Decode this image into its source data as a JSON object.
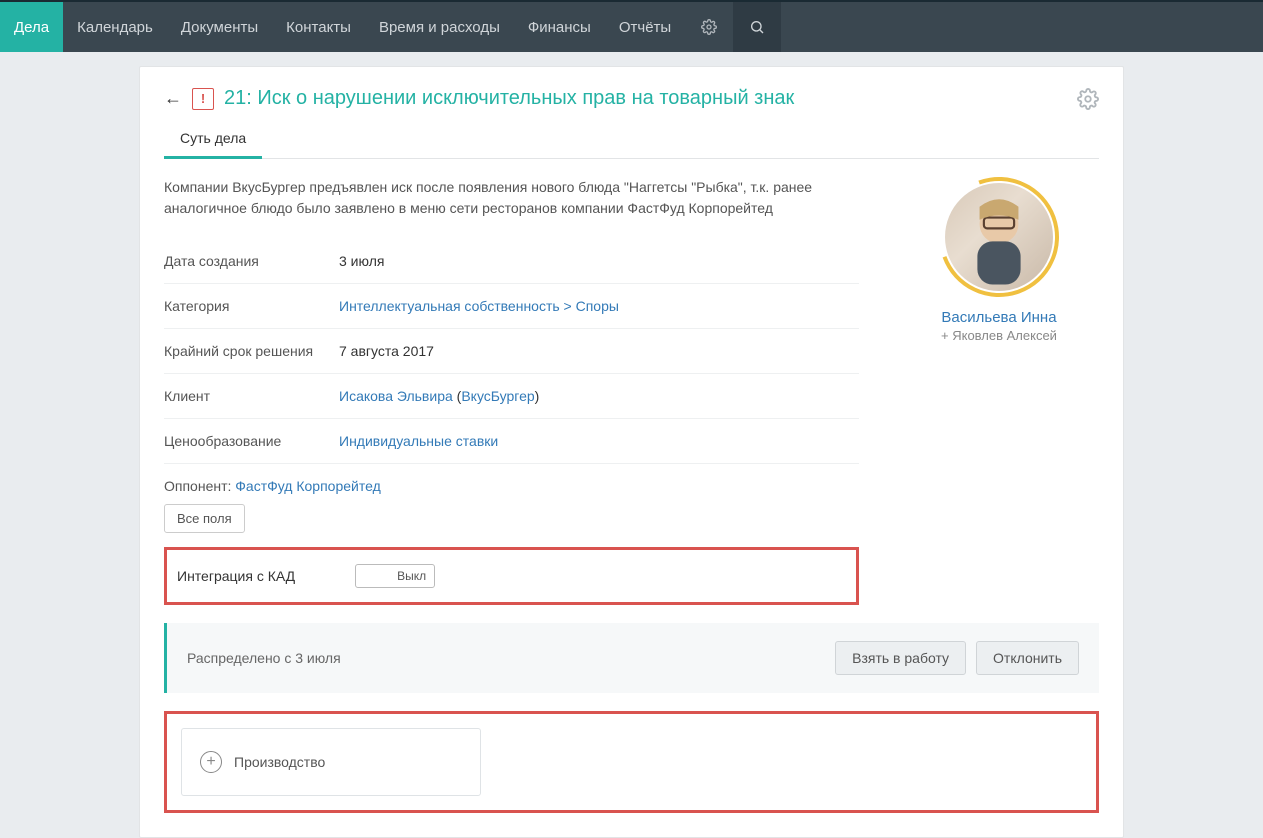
{
  "nav": {
    "items": [
      {
        "label": "Дела",
        "active": true
      },
      {
        "label": "Календарь"
      },
      {
        "label": "Документы"
      },
      {
        "label": "Контакты"
      },
      {
        "label": "Время и расходы"
      },
      {
        "label": "Финансы"
      },
      {
        "label": "Отчёты"
      }
    ]
  },
  "case": {
    "title": "21: Иск о нарушении исключительных прав на товарный знак",
    "warn_mark": "!",
    "tab_label": "Суть дела",
    "description": "Компании ВкусБургер предъявлен иск после появления нового блюда \"Наггетсы \"Рыбка\", т.к. ранее аналогичное блюдо было заявлено в меню сети ресторанов компании ФастФуд Корпорейтед",
    "fields": {
      "created_label": "Дата создания",
      "created_value": "3 июля",
      "category_label": "Категория",
      "category_value": "Интеллектуальная собственность > Споры",
      "deadline_label": "Крайний срок решения",
      "deadline_value": "7 августа 2017",
      "client_label": "Клиент",
      "client_person": "Исакова Эльвира",
      "client_company": "ВкусБургер",
      "pricing_label": "Ценообразование",
      "pricing_value": "Индивидуальные ставки",
      "opponent_label": "Оппонент:",
      "opponent_value": "ФастФуд Корпорейтед"
    },
    "all_fields_btn": "Все поля",
    "kad_label": "Интеграция с КАД",
    "kad_toggle": "Выкл",
    "status_text": "Распределено с 3 июля",
    "take_btn": "Взять в работу",
    "reject_btn": "Отклонить",
    "production_label": "Производство"
  },
  "assignee": {
    "name": "Васильева Инна",
    "sub": "+ Яковлев Алексей"
  }
}
